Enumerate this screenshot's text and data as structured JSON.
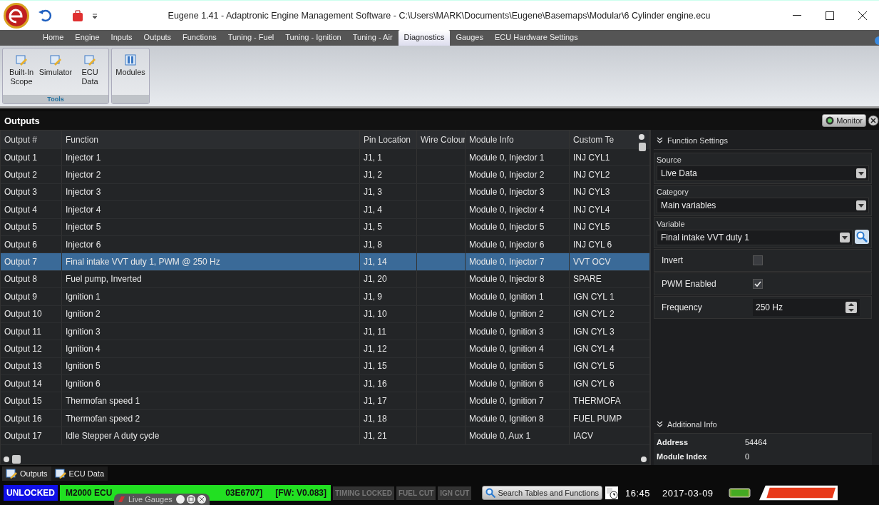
{
  "window": {
    "title": "Eugene 1.41 - Adaptronic Engine Management Software - C:\\Users\\MARK\\Documents\\Eugene\\Basemaps\\Modular\\6 Cylinder engine.ecu"
  },
  "menu_tabs": [
    {
      "label": "Home",
      "selected": false
    },
    {
      "label": "Engine",
      "selected": false
    },
    {
      "label": "Inputs",
      "selected": false
    },
    {
      "label": "Outputs",
      "selected": false
    },
    {
      "label": "Functions",
      "selected": false
    },
    {
      "label": "Tuning - Fuel",
      "selected": false
    },
    {
      "label": "Tuning - Ignition",
      "selected": false
    },
    {
      "label": "Tuning - Air",
      "selected": false
    },
    {
      "label": "Diagnostics",
      "selected": true
    },
    {
      "label": "Gauges",
      "selected": false
    },
    {
      "label": "ECU Hardware Settings",
      "selected": false
    }
  ],
  "ribbon_groups": [
    {
      "label": "Tools",
      "buttons": [
        {
          "label": "Built-In Scope",
          "kind": "tool"
        },
        {
          "label": "Simulator",
          "kind": "tool"
        },
        {
          "label": "ECU Data",
          "kind": "tool"
        }
      ]
    },
    {
      "buttons": [
        {
          "label": "Modules",
          "kind": "modules"
        }
      ]
    }
  ],
  "panel": {
    "title": "Outputs",
    "monitor": "Monitor"
  },
  "table": {
    "columns": [
      "Output #",
      "Function",
      "Pin Location",
      "Wire Colour",
      "Module Info",
      "Custom Te"
    ],
    "rows": [
      {
        "output": "Output 1",
        "function": "Injector 1",
        "pin": "J1, 1",
        "module": "Module 0, Injector 1",
        "custom": "INJ CYL1",
        "selected": false
      },
      {
        "output": "Output 2",
        "function": "Injector 2",
        "pin": "J1, 2",
        "module": "Module 0, Injector 2",
        "custom": "INJ CYL2",
        "selected": false
      },
      {
        "output": "Output 3",
        "function": "Injector 3",
        "pin": "J1, 3",
        "module": "Module 0, Injector 3",
        "custom": "INJ CYL3",
        "selected": false
      },
      {
        "output": "Output 4",
        "function": "Injector 4",
        "pin": "J1, 4",
        "module": "Module 0, Injector 4",
        "custom": "INJ CYL4",
        "selected": false
      },
      {
        "output": "Output 5",
        "function": "Injector 5",
        "pin": "J1, 5",
        "module": "Module 0, Injector 5",
        "custom": "INJ CYL5",
        "selected": false
      },
      {
        "output": "Output 6",
        "function": "Injector 6",
        "pin": "J1, 8",
        "module": "Module 0, Injector 6",
        "custom": "INJ CYL 6",
        "selected": false
      },
      {
        "output": "Output 7",
        "function": "Final intake VVT duty 1, PWM @ 250 Hz",
        "pin": "J1, 14",
        "module": "Module 0, Injector 7",
        "custom": "VVT OCV",
        "selected": true
      },
      {
        "output": "Output 8",
        "function": "Fuel pump, Inverted",
        "pin": "J1, 20",
        "module": "Module 0, Injector 8",
        "custom": "SPARE",
        "selected": false
      },
      {
        "output": "Output 9",
        "function": "Ignition 1",
        "pin": "J1, 9",
        "module": "Module 0, Ignition 1",
        "custom": "IGN CYL 1",
        "selected": false
      },
      {
        "output": "Output 10",
        "function": "Ignition 2",
        "pin": "J1, 10",
        "module": "Module 0, Ignition 2",
        "custom": "IGN CYL 2",
        "selected": false
      },
      {
        "output": "Output 11",
        "function": "Ignition 3",
        "pin": "J1, 11",
        "module": "Module 0, Ignition 3",
        "custom": "IGN CYL 3",
        "selected": false
      },
      {
        "output": "Output 12",
        "function": "Ignition 4",
        "pin": "J1, 12",
        "module": "Module 0, Ignition 4",
        "custom": "IGN CYL 4",
        "selected": false
      },
      {
        "output": "Output 13",
        "function": "Ignition 5",
        "pin": "J1, 15",
        "module": "Module 0, Ignition 5",
        "custom": "IGN CYL 5",
        "selected": false
      },
      {
        "output": "Output 14",
        "function": "Ignition 6",
        "pin": "J1, 16",
        "module": "Module 0, Ignition 6",
        "custom": "IGN CYL 6",
        "selected": false
      },
      {
        "output": "Output 15",
        "function": "Thermofan speed 1",
        "pin": "J1, 17",
        "module": "Module 0, Ignition 7",
        "custom": "THERMOFA",
        "selected": false
      },
      {
        "output": "Output 16",
        "function": "Thermofan speed 2",
        "pin": "J1, 18",
        "module": "Module 0, Ignition 8",
        "custom": "FUEL PUMP",
        "selected": false
      },
      {
        "output": "Output 17",
        "function": "Idle Stepper A duty cycle",
        "pin": "J1, 21",
        "module": "Module 0, Aux 1",
        "custom": "IACV",
        "selected": false
      }
    ]
  },
  "function_settings": {
    "title": "Function Settings",
    "fields": [
      {
        "label": "Source",
        "value": "Live Data",
        "search": false
      },
      {
        "label": "Category",
        "value": "Main variables",
        "search": false
      },
      {
        "label": "Variable",
        "value": "Final intake VVT duty 1",
        "search": true
      }
    ],
    "options": [
      {
        "kind": "checkbox",
        "label": "Invert",
        "checked": false
      },
      {
        "kind": "checkbox",
        "label": "PWM Enabled",
        "checked": true
      },
      {
        "kind": "spinner",
        "label": "Frequency",
        "value": "250 Hz"
      }
    ]
  },
  "additional_info": {
    "title": "Additional Info",
    "rows": [
      {
        "label": "Address",
        "value": "54464"
      },
      {
        "label": "Module Index",
        "value": "0"
      }
    ]
  },
  "bottom_tabs": [
    {
      "label": "Outputs",
      "selected": true
    },
    {
      "label": "ECU Data",
      "selected": false
    }
  ],
  "status_bar": {
    "lock": "UNLOCKED",
    "ecu": [
      "M2000 ECU",
      "03E6707]",
      "[FW:  V0.083]"
    ],
    "indicators": [
      {
        "label": "TIMING LOCKED",
        "active": false
      },
      {
        "label": "FUEL CUT",
        "active": false
      },
      {
        "label": "IGN CUT",
        "active": false
      }
    ],
    "search": "Search Tables and Functions",
    "time": "16:45",
    "date": "2017-03-09"
  },
  "floating_window": {
    "title": "Live Gauges"
  }
}
